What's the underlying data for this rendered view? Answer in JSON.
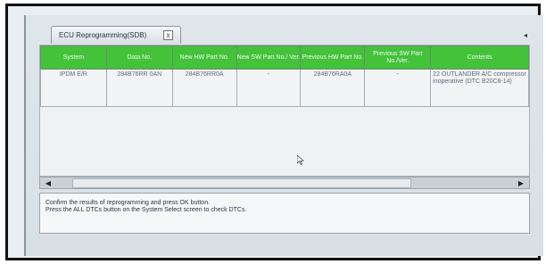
{
  "tab": {
    "title": "ECU Reprogramming(SDB)",
    "close_glyph": "x"
  },
  "table": {
    "headers": [
      "System",
      "Data No.",
      "New HW Part No.",
      "New SW Part No./ Ver.",
      "Previous HW Part No.",
      "Previous SW Part No./Ver.",
      "Contents"
    ],
    "rows": [
      [
        "IPDM E/R",
        "284B76RR 0AN",
        "284B76RR0A",
        "-",
        "284B76RA0A",
        "-",
        "22 OUTLANDER A/C compressor inoperative (DTC B20C8-14)"
      ]
    ]
  },
  "message": {
    "line1": "Confirm the results of reprogramming and press OK button.",
    "line2": "Press the ALL DTCs button on the System Select screen to check DTCs."
  },
  "icons": {
    "left_arrow": "◀",
    "right_arrow": "▶",
    "tab_scroll": "◂"
  },
  "colors": {
    "header_green": "#43c23a"
  }
}
